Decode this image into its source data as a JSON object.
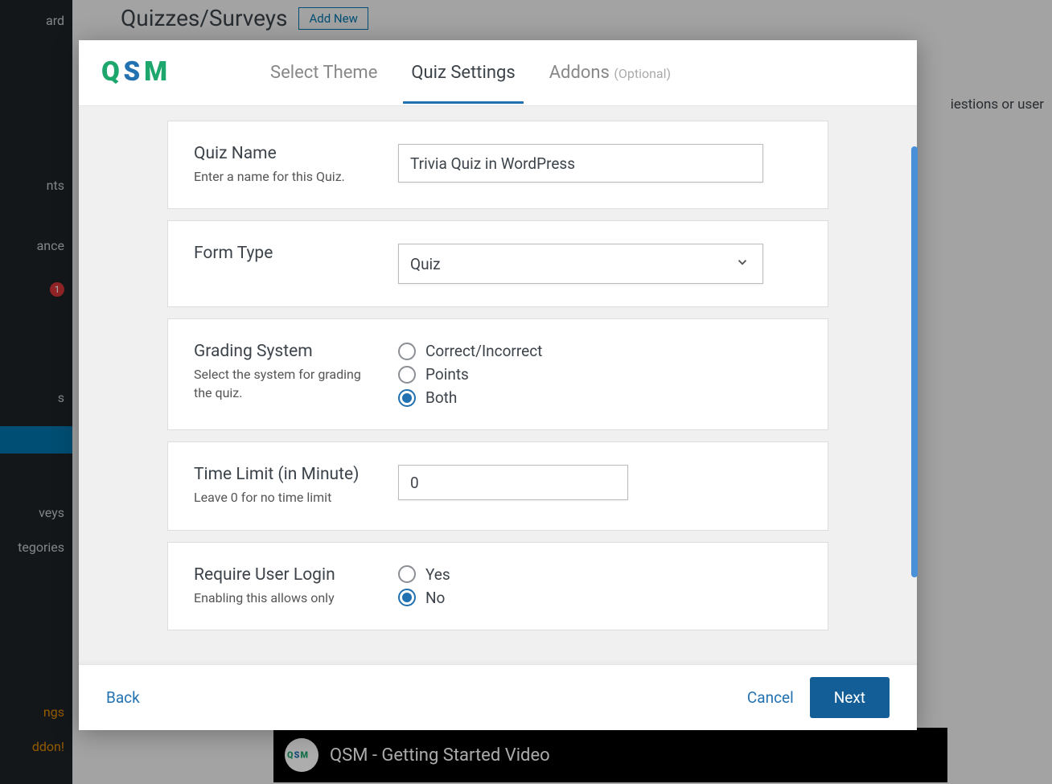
{
  "wp": {
    "page_title": "Quizzes/Surveys",
    "add_new": "Add New",
    "sidebar": {
      "items": [
        "ard",
        "nts",
        "ance",
        "",
        "s",
        "",
        "",
        "veys",
        "tegories",
        "ngs",
        "ddon!"
      ],
      "badge": "1"
    },
    "right_hint": "iestions or user",
    "video_title": "QSM - Getting Started Video"
  },
  "modal": {
    "tabs": {
      "select_theme": "Select Theme",
      "quiz_settings": "Quiz Settings",
      "addons": "Addons",
      "optional": "(Optional)"
    },
    "quiz_name": {
      "label": "Quiz Name",
      "sub": "Enter a name for this Quiz.",
      "value": "Trivia Quiz in WordPress"
    },
    "form_type": {
      "label": "Form Type",
      "value": "Quiz"
    },
    "grading": {
      "label": "Grading System",
      "sub": "Select the system for grading the quiz.",
      "options": [
        "Correct/Incorrect",
        "Points",
        "Both"
      ],
      "selected": 2
    },
    "time_limit": {
      "label": "Time Limit (in Minute)",
      "sub": "Leave 0 for no time limit",
      "value": "0"
    },
    "require_login": {
      "label": "Require User Login",
      "sub": "Enabling this allows only",
      "options": [
        "Yes",
        "No"
      ],
      "selected": 1
    },
    "footer": {
      "back": "Back",
      "cancel": "Cancel",
      "next": "Next"
    }
  }
}
